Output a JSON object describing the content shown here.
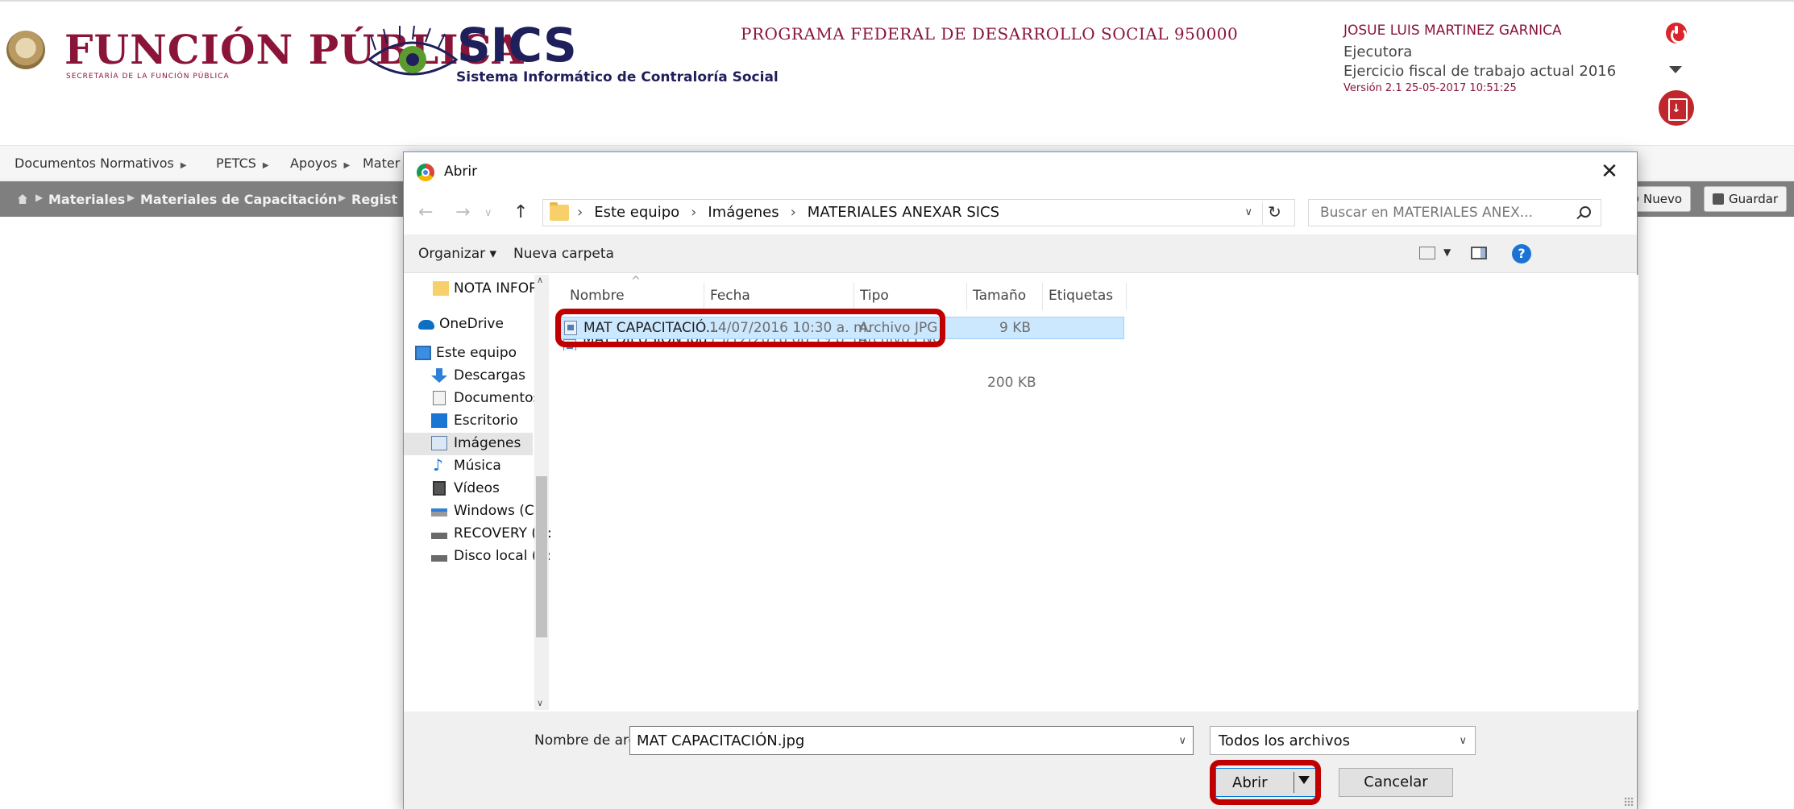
{
  "header": {
    "logo_title": "FUNCIÓN PÚBLICA",
    "logo_subtitle": "SECRETARÍA DE LA FUNCIÓN PÚBLICA",
    "sics_title": "SICS",
    "sics_subtitle": "Sistema Informático de Contraloría Social",
    "program": "PROGRAMA FEDERAL DE DESARROLLO SOCIAL 950000",
    "user_name": "JOSUE LUIS MARTINEZ GARNICA",
    "user_role": "Ejecutora",
    "fiscal_year": "Ejercicio fiscal de trabajo actual 2016",
    "version": "Versión 2.1   25-05-2017 10:51:25"
  },
  "menu": [
    {
      "label": "Documentos Normativos"
    },
    {
      "label": "PETCS"
    },
    {
      "label": "Apoyos"
    },
    {
      "label": "Mater"
    }
  ],
  "breadcrumb": [
    {
      "label": "Materiales"
    },
    {
      "label": "Materiales de Capacitación"
    },
    {
      "label": "Regist"
    }
  ],
  "toolbar": {
    "new_label": "Nuevo",
    "save_label": "Guardar"
  },
  "dialog": {
    "title": "Abrir",
    "close_glyph": "✕",
    "path": [
      "Este equipo",
      "Imágenes",
      "MATERIALES ANEXAR SICS"
    ],
    "search_placeholder": "Buscar en MATERIALES ANEX...",
    "organize_label": "Organizar ▾",
    "new_folder_label": "Nueva carpeta",
    "nav_items": [
      {
        "label": "NOTA INFORMA",
        "icon": "folder-icon"
      },
      {
        "label": "OneDrive",
        "icon": "onedrive-icon"
      },
      {
        "label": "Este equipo",
        "icon": "computer-icon"
      },
      {
        "label": "Descargas",
        "icon": "downloads-icon"
      },
      {
        "label": "Documentos",
        "icon": "documents-icon"
      },
      {
        "label": "Escritorio",
        "icon": "desktop-icon"
      },
      {
        "label": "Imágenes",
        "icon": "pictures-icon",
        "selected": true
      },
      {
        "label": "Música",
        "icon": "music-icon"
      },
      {
        "label": "Vídeos",
        "icon": "videos-icon"
      },
      {
        "label": "Windows (C:)",
        "icon": "drive-c-icon"
      },
      {
        "label": "RECOVERY (D:)",
        "icon": "drive-d-icon"
      },
      {
        "label": "Disco local (Z:)",
        "icon": "drive-z-icon"
      }
    ],
    "columns": [
      "Nombre",
      "Fecha",
      "Tipo",
      "Tamaño",
      "Etiquetas"
    ],
    "files": [
      {
        "name": "MAT CAPACITACIÓ...",
        "date": "14/07/2016 10:30 a. m.",
        "type": "Archivo JPG",
        "size": "9 KB",
        "selected": true
      },
      {
        "name": "MAT DIFUSIÓN.jpg",
        "date": "13/12/2016 08:19 p. m.",
        "type": "Archivo PNG",
        "size": "200 KB",
        "selected": false
      }
    ],
    "filename_label": "Nombre de archivo:",
    "filename_value": "MAT CAPACITACIÓN.jpg",
    "filetype_value": "Todos los archivos",
    "open_label": "Abrir",
    "cancel_label": "Cancelar"
  },
  "colors": {
    "brand": "#8a1538",
    "sics_navy": "#1f1f5c",
    "highlight": "#c00000",
    "selection": "#cce8ff"
  }
}
